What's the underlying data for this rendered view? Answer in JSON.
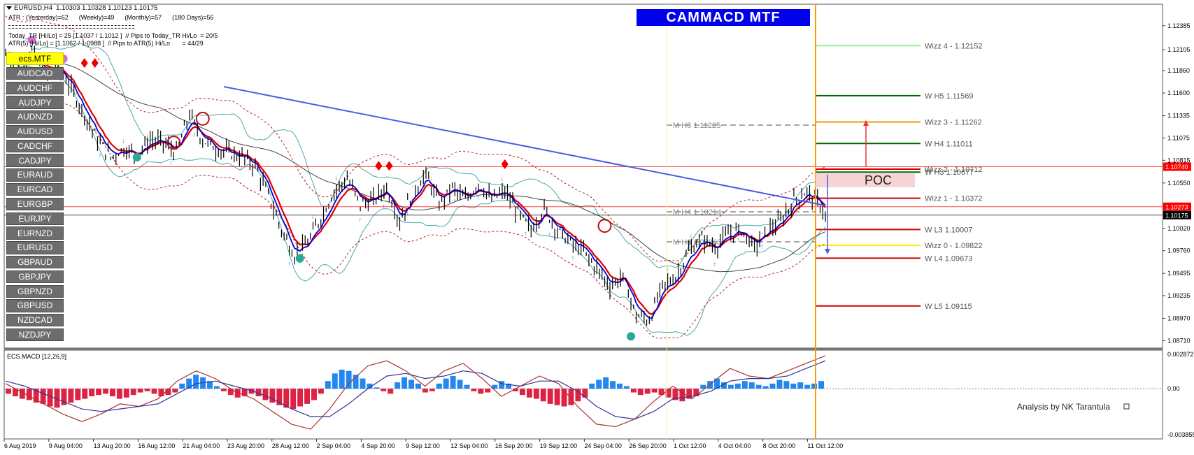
{
  "header": {
    "symbol_line": "EURUSD,H4  1.10303 1.10328 1.10123 1.10175",
    "atr_line": "ATR : (Yesterday)=62      (Weekly)=49      (Monthly)=57      (180 Days)=56",
    "today_line": "Today_TR [Hi/Lo] = 25 [1.1037 / 1.1012 ]  // Pips to Today_TR Hi/Lo  = 20/5",
    "atr5_line": "ATR(5) [Hi/Lo] = [1.1062 / 1.0988 ]  // Pips to ATR(5) Hi/Lo       = 44/29"
  },
  "banner": "CAMMACD MTF",
  "credit": "Analysis by NK Tarantula",
  "symbols": {
    "active": "ecs.MTF",
    "items": [
      "AUDCAD",
      "AUDCHF",
      "AUDJPY",
      "AUDNZD",
      "AUDUSD",
      "CADCHF",
      "CADJPY",
      "EURAUD",
      "EURCAD",
      "EURGBP",
      "EURJPY",
      "EURNZD",
      "EURUSD",
      "GBPAUD",
      "GBPJPY",
      "GBPNZD",
      "GBPUSD",
      "NZDCAD",
      "NZDJPY"
    ]
  },
  "colors": {
    "price_bar": "#000000",
    "ema_red": "#e00000",
    "ema_blue": "#0000dd",
    "bollinger": "#4aa9a9",
    "envelope": "#b22222",
    "trendline": "#4a5fe0",
    "vline": "#ff9900",
    "macd_pos": "#2288ee",
    "macd_neg": "#dd2244"
  },
  "chart_data": [
    {
      "type": "line",
      "title": "EURUSD,H4",
      "ylim": [
        1.0864,
        1.1262
      ],
      "y_ticks": [
        "1.12385",
        "1.12105",
        "1.11860",
        "1.11600",
        "1.11335",
        "1.11075",
        "1.10815",
        "1.10550",
        "1.10290",
        "1.10020",
        "1.09760",
        "1.09495",
        "1.09235",
        "1.08970",
        "1.08710"
      ],
      "price_tags": [
        {
          "label": "1.10740",
          "value": 1.1074,
          "color": "#ff0000"
        },
        {
          "label": "1.10273",
          "value": 1.10273,
          "color": "#ff0000"
        },
        {
          "label": "1.10175",
          "value": 1.10175,
          "color": "#000000"
        }
      ],
      "x_labels": [
        "6 Aug 2019",
        "9 Aug 04:00",
        "13 Aug 20:00",
        "16 Aug 12:00",
        "21 Aug 04:00",
        "23 Aug 20:00",
        "28 Aug 12:00",
        "2 Sep 04:00",
        "4 Sep 20:00",
        "9 Sep 12:00",
        "12 Sep 04:00",
        "16 Sep 20:00",
        "19 Sep 12:00",
        "24 Sep 04:00",
        "26 Sep 20:00",
        "1 Oct 12:00",
        "4 Oct 04:00",
        "8 Oct 20:00",
        "11 Oct 12:00"
      ],
      "close_path": [
        [
          0,
          1.1205
        ],
        [
          5,
          1.1195
        ],
        [
          10,
          1.121
        ],
        [
          15,
          1.118
        ],
        [
          20,
          1.119
        ],
        [
          25,
          1.1165
        ],
        [
          30,
          1.1135
        ],
        [
          35,
          1.1105
        ],
        [
          40,
          1.1085
        ],
        [
          45,
          1.1095
        ],
        [
          50,
          1.1088
        ],
        [
          55,
          1.1105
        ],
        [
          60,
          1.1102
        ],
        [
          65,
          1.109
        ],
        [
          70,
          1.1135
        ],
        [
          75,
          1.1105
        ],
        [
          80,
          1.1095
        ],
        [
          85,
          1.109
        ],
        [
          90,
          1.1085
        ],
        [
          95,
          1.1075
        ],
        [
          100,
          1.104
        ],
        [
          105,
          1.1
        ],
        [
          110,
          1.097
        ],
        [
          115,
          1.0985
        ],
        [
          120,
          1.1015
        ],
        [
          125,
          1.1045
        ],
        [
          130,
          1.106
        ],
        [
          135,
          1.103
        ],
        [
          140,
          1.1035
        ],
        [
          145,
          1.105
        ],
        [
          150,
          1.101
        ],
        [
          155,
          1.1045
        ],
        [
          160,
          1.1065
        ],
        [
          165,
          1.103
        ],
        [
          170,
          1.105
        ],
        [
          175,
          1.1035
        ],
        [
          180,
          1.1055
        ],
        [
          185,
          1.1035
        ],
        [
          190,
          1.1045
        ],
        [
          195,
          1.102
        ],
        [
          200,
          1.1
        ],
        [
          205,
          1.1025
        ],
        [
          210,
          1.1
        ],
        [
          215,
          1.0985
        ],
        [
          220,
          1.0975
        ],
        [
          225,
          1.0955
        ],
        [
          230,
          1.0935
        ],
        [
          235,
          1.0945
        ],
        [
          240,
          1.09
        ],
        [
          245,
          1.0895
        ],
        [
          250,
          1.0935
        ],
        [
          255,
          1.0945
        ],
        [
          260,
          1.0975
        ],
        [
          265,
          1.099
        ],
        [
          270,
          1.098
        ],
        [
          275,
          1.0995
        ],
        [
          280,
          1.1
        ],
        [
          285,
          1.098
        ],
        [
          290,
          1.1
        ],
        [
          295,
          1.101
        ],
        [
          300,
          1.1035
        ],
        [
          305,
          1.1045
        ],
        [
          310,
          1.103
        ],
        [
          312,
          1.10175
        ]
      ],
      "levels": [
        {
          "label": "W  H5 1.11569",
          "value": 1.11569,
          "color": "#006600"
        },
        {
          "label": "W  H4 1.11011",
          "value": 1.11011,
          "color": "#006600"
        },
        {
          "label": "W  H3 1.10677",
          "value": 1.10677,
          "color": "#006600"
        },
        {
          "label": "W  L3 1.10007",
          "value": 1.10007,
          "color": "#cc0000"
        },
        {
          "label": "W  L4 1.09673",
          "value": 1.09673,
          "color": "#cc0000"
        },
        {
          "label": "W  L5 1.09115",
          "value": 1.09115,
          "color": "#cc0000"
        },
        {
          "label": "M  H5 1.11225",
          "value": 1.11225,
          "color": "#888888"
        },
        {
          "label": "M  H4 1.10214",
          "value": 1.10214,
          "color": "#888888"
        },
        {
          "label": "M  H3 1.09863",
          "value": 1.09863,
          "color": "#888888"
        },
        {
          "label": "Wizz 4 - 1.12152",
          "value": 1.12152,
          "color": "#99ee99"
        },
        {
          "label": "Wizz 3 - 1.11262",
          "value": 1.11262,
          "color": "#ee9900"
        },
        {
          "label": "Wizz 2 - 1.10712",
          "value": 1.10712,
          "color": "#cc0000"
        },
        {
          "label": "Wizz 1 - 1.10372",
          "value": 1.10372,
          "color": "#cc0000"
        },
        {
          "label": "Wizz 0 - 1.09822",
          "value": 1.09822,
          "color": "#ffee00"
        }
      ],
      "poc_label": "POC"
    },
    {
      "type": "bar",
      "title": "ECS.MACD [12,26,9]",
      "ylim": [
        -0.003855,
        0.0028721
      ],
      "y_ticks": [
        "0.0028721",
        "0.00",
        "-0.003855"
      ],
      "histogram": [
        -0.0004,
        -0.0006,
        -0.0008,
        -0.0009,
        -0.0011,
        -0.0012,
        -0.0014,
        -0.0015,
        -0.0013,
        -0.0011,
        -0.0009,
        -0.0008,
        -0.0006,
        -0.0005,
        -0.0004,
        -0.0006,
        -0.0008,
        -0.0007,
        -0.0005,
        -0.0003,
        -0.0002,
        -0.0004,
        -0.0006,
        -0.0005,
        -0.0003,
        0.0004,
        0.0008,
        0.0011,
        0.0009,
        0.0006,
        0.0002,
        -0.0002,
        -0.0005,
        -0.0007,
        -0.0006,
        -0.0004,
        -0.0006,
        -0.0009,
        -0.0011,
        -0.0013,
        -0.0015,
        -0.0016,
        -0.0014,
        -0.0012,
        -0.0009,
        -0.0004,
        0.0006,
        0.0012,
        0.0015,
        0.0014,
        0.0011,
        0.0008,
        0.0004,
        0.0001,
        -0.0002,
        -0.0004,
        0.0005,
        0.0009,
        0.0007,
        0.0004,
        -0.0003,
        -0.0002,
        0.0004,
        0.0008,
        0.001,
        0.0007,
        0.0003,
        -0.0002,
        -0.0004,
        -0.0003,
        0.0003,
        0.0006,
        0.0004,
        -0.0002,
        -0.0005,
        -0.0007,
        -0.0008,
        -0.001,
        -0.0012,
        -0.0013,
        -0.0014,
        -0.0013,
        -0.001,
        -0.0007,
        0.0004,
        0.0007,
        0.0009,
        0.0006,
        0.0004,
        0.0002,
        -0.0003,
        -0.0005,
        -0.0004,
        -0.0003,
        -0.0005,
        -0.0007,
        -0.0009,
        -0.001,
        -0.0008,
        -0.0006,
        0.0003,
        0.0006,
        0.0008,
        0.0005,
        0.0003,
        0.0004,
        0.0006,
        0.0005,
        0.0003,
        0.0002,
        0.0004,
        0.0007,
        0.0006,
        0.0004,
        0.0005,
        0.0003,
        0.0004,
        0.0006
      ],
      "macd_line": [
        0.0004,
        -0.0004,
        -0.0012,
        -0.002,
        -0.0026,
        -0.002,
        -0.0012,
        -0.0014,
        -0.0008,
        0.0006,
        0.0014,
        0.0008,
        -0.0002,
        -0.0008,
        -0.0018,
        -0.0028,
        -0.0032,
        -0.0016,
        0.0004,
        0.0018,
        0.0022,
        0.0014,
        0.0002,
        0.0014,
        0.002,
        0.0008,
        -0.0006,
        0.0002,
        0.001,
        0.0004,
        -0.0014,
        -0.0028,
        -0.003,
        -0.0024,
        -0.001,
        0.0002,
        -0.0008,
        0.0004,
        0.0016,
        0.001,
        0.0008,
        0.0014,
        0.002,
        0.0026
      ],
      "signal_line": [
        0.0006,
        0.0002,
        -0.0004,
        -0.001,
        -0.0016,
        -0.0018,
        -0.0016,
        -0.0014,
        -0.0012,
        -0.0004,
        0.0004,
        0.0006,
        0.0002,
        -0.0002,
        -0.0008,
        -0.0016,
        -0.0022,
        -0.0022,
        -0.0012,
        0.0,
        0.001,
        0.0012,
        0.0008,
        0.001,
        0.0014,
        0.0012,
        0.0004,
        0.0002,
        0.0006,
        0.0006,
        -0.0002,
        -0.0014,
        -0.0022,
        -0.0024,
        -0.0018,
        -0.0008,
        -0.0006,
        -0.0002,
        0.0006,
        0.0008,
        0.0008,
        0.001,
        0.0016,
        0.0022
      ]
    }
  ]
}
